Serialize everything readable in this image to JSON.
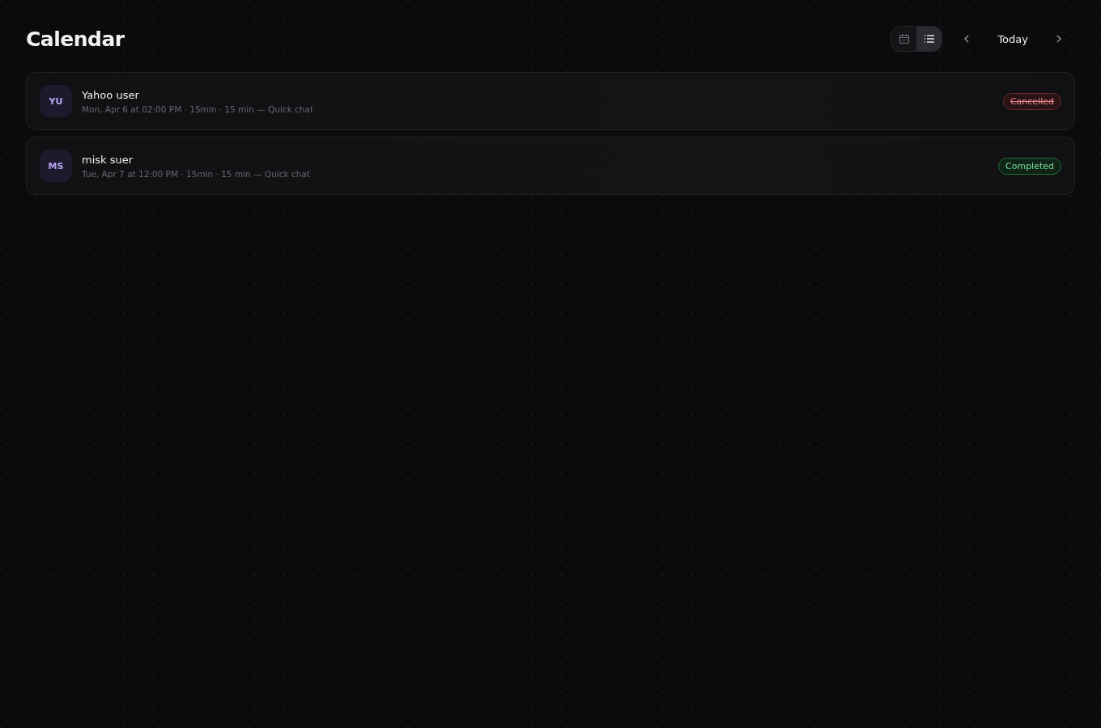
{
  "header": {
    "title": "Calendar",
    "views": [
      {
        "kind": "calendar",
        "selected": false
      },
      {
        "kind": "list",
        "selected": true
      }
    ],
    "today": "Today"
  },
  "events": [
    {
      "initials": "YU",
      "name": "Yahoo user",
      "details": "Mon, Apr 6 at 02:00 PM · 15min · 15 min — Quick chat",
      "status": "Cancelled",
      "kind": "cancelled"
    },
    {
      "initials": "MS",
      "name": "misk suer",
      "details": "Tue, Apr 7 at 12:00 PM · 15min · 15 min — Quick chat",
      "status": "Completed",
      "kind": "completed"
    }
  ]
}
